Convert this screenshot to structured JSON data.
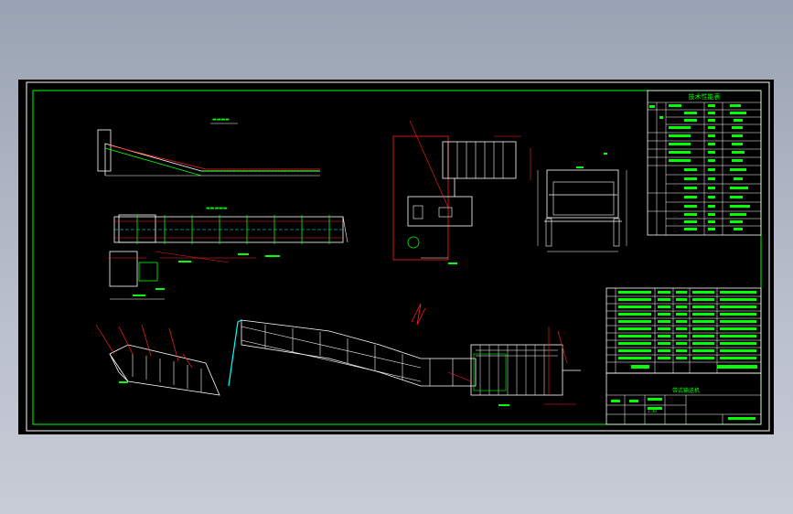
{
  "tech_table": {
    "title": "技术性能表"
  },
  "title_block": {
    "drawing_name": "带式输送机",
    "scale": "1:30"
  },
  "colors": {
    "frame": "#ffffff",
    "green": "#00ff00",
    "red": "#ff2020",
    "cyan": "#00ffff",
    "yellow": "#ffff00",
    "magenta": "#ff00ff"
  }
}
